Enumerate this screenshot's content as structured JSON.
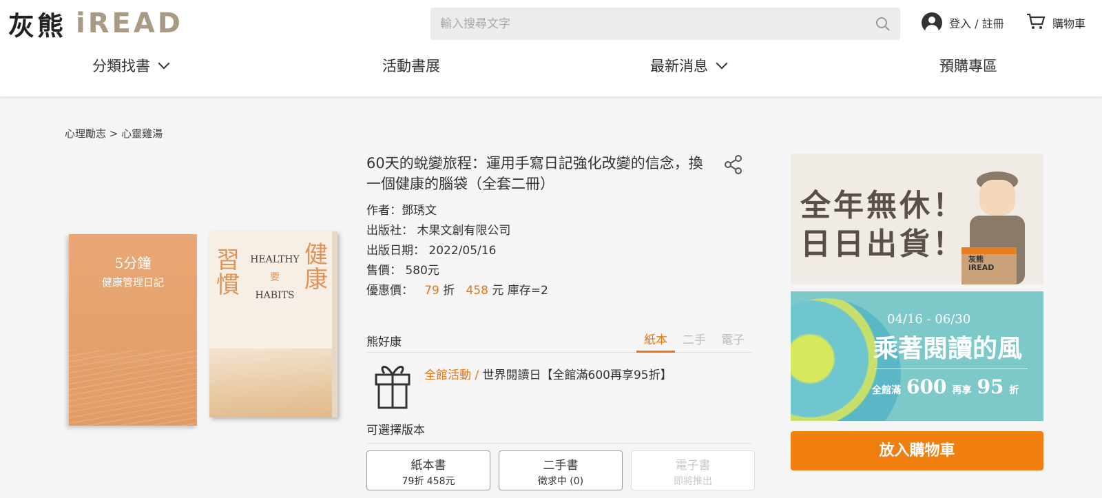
{
  "brand": {
    "logo_cn": "灰熊",
    "logo_en": "iREAD"
  },
  "search": {
    "placeholder": "輸入搜尋文字",
    "icon": "search-icon"
  },
  "user": {
    "login_label": "登入 / 註冊",
    "icon": "user-icon"
  },
  "cart": {
    "label": "購物車",
    "icon": "cart-icon"
  },
  "nav": {
    "items": [
      {
        "label": "分類找書",
        "dropdown": true
      },
      {
        "label": "活動書展",
        "dropdown": false
      },
      {
        "label": "最新消息",
        "dropdown": true
      },
      {
        "label": "預購專區",
        "dropdown": false
      }
    ]
  },
  "breadcrumb": {
    "items": [
      "心理勵志",
      "心靈雞湯"
    ],
    "separator": ">"
  },
  "book": {
    "title": "60天的蛻變旅程：運用手寫日記強化改變的信念，換一個健康的腦袋（全套二冊）",
    "author_label": "作者：",
    "author": "鄧琇文",
    "publisher_label": "出版社：",
    "publisher": "木果文創有限公司",
    "date_label": "出版日期：",
    "date": "2022/05/16",
    "price_label": "售價：",
    "price": "580元",
    "discount_label": "優惠價：",
    "discount_rate": "79",
    "discount_unit": "折",
    "discount_price": "458",
    "price_unit": "元",
    "stock": "庫存=2",
    "cover1": {
      "line1": "5分鐘",
      "line2": "健康管理日記"
    },
    "cover2": {
      "big1": "習慣",
      "big2": "健康",
      "eng1": "HEALTHY",
      "eng_mid": "要",
      "eng2": "HABITS"
    }
  },
  "seller": {
    "name": "熊好康",
    "formats": [
      "紙本",
      "二手",
      "電子"
    ],
    "active_format": "紙本"
  },
  "promo": {
    "tag": "全館活動 /",
    "text": "世界閱讀日【全館滿600再享95折】",
    "icon": "gift-icon"
  },
  "versions": {
    "label": "可選擇版本",
    "options": [
      {
        "name": "紙本書",
        "detail": "79折 458元",
        "enabled": true
      },
      {
        "name": "二手書",
        "detail": "徵求中 (0)",
        "enabled": true
      },
      {
        "name": "電子書",
        "detail": "即將推出",
        "enabled": false
      }
    ]
  },
  "banners": {
    "b1": {
      "line1": "全年無休！",
      "line2": "日日出貨！",
      "box_cn": "灰熊",
      "box_en": "iREAD"
    },
    "b2": {
      "date": "04/16 - 06/30",
      "title": "乘著閱讀的風",
      "sub1": "全館滿",
      "n1": "600",
      "sub2": "再享",
      "n2": "95",
      "sub3": "折"
    }
  },
  "add_to_cart": {
    "label": "放入購物車"
  },
  "colors": {
    "accent": "#f07f10",
    "text": "#333333",
    "bg": "#f5f5f5"
  }
}
